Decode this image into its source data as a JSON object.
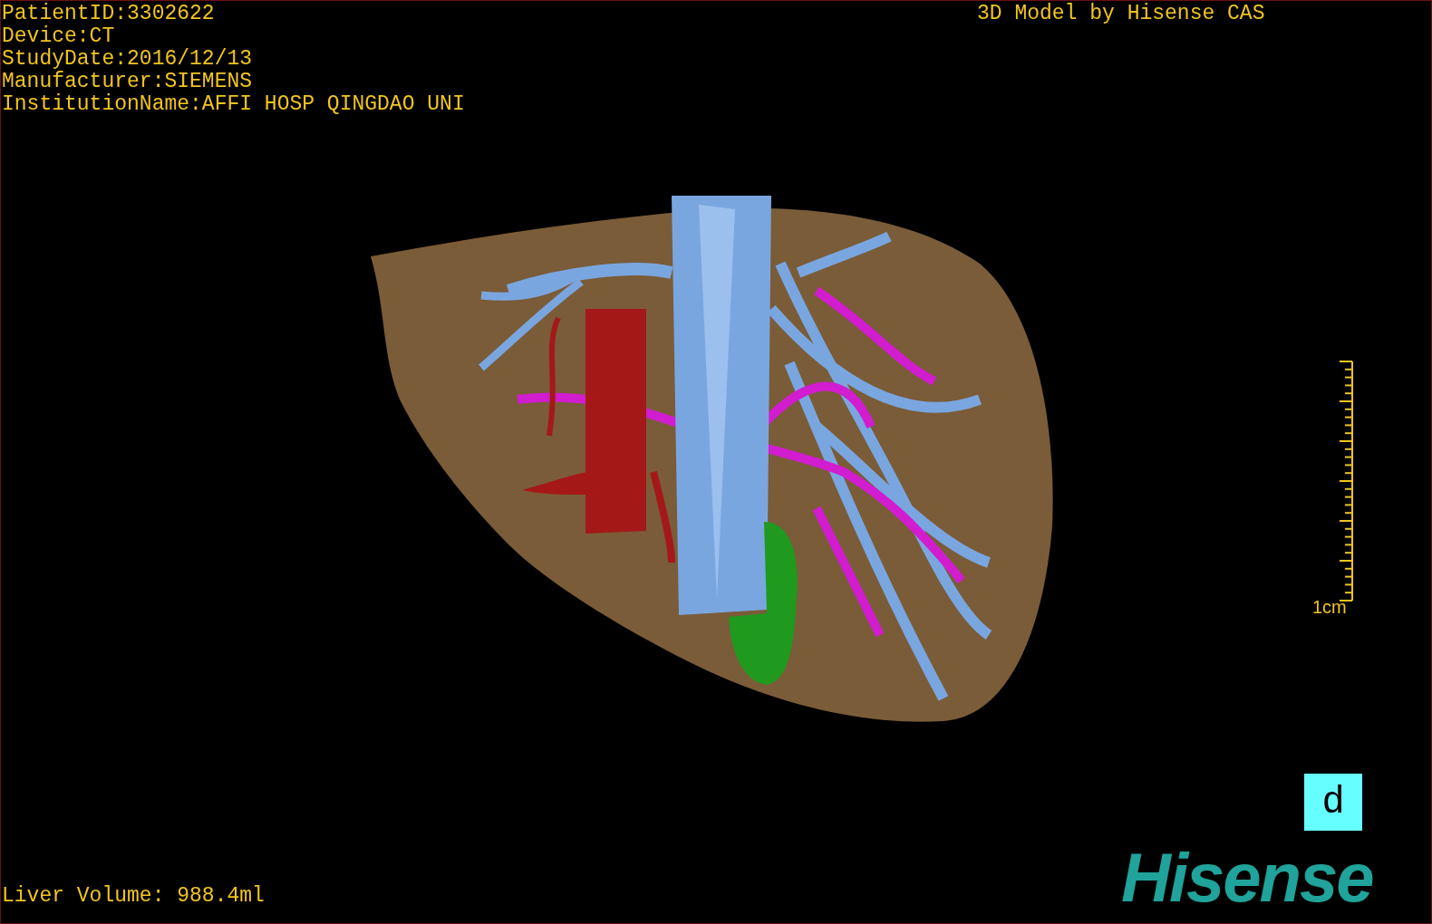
{
  "viewer": {
    "info_lines": [
      "PatientID:3302622",
      "Device:CT",
      "StudyDate:2016/12/13",
      "Manufacturer:SIEMENS",
      "InstitutionName:AFFI HOSP QINGDAO UNI"
    ],
    "title": "3D Model by Hisense CAS",
    "scale_label": "1cm",
    "orientation_button": "d",
    "logo": "Hisense",
    "liver_volume": "Liver Volume: 988.4ml"
  }
}
